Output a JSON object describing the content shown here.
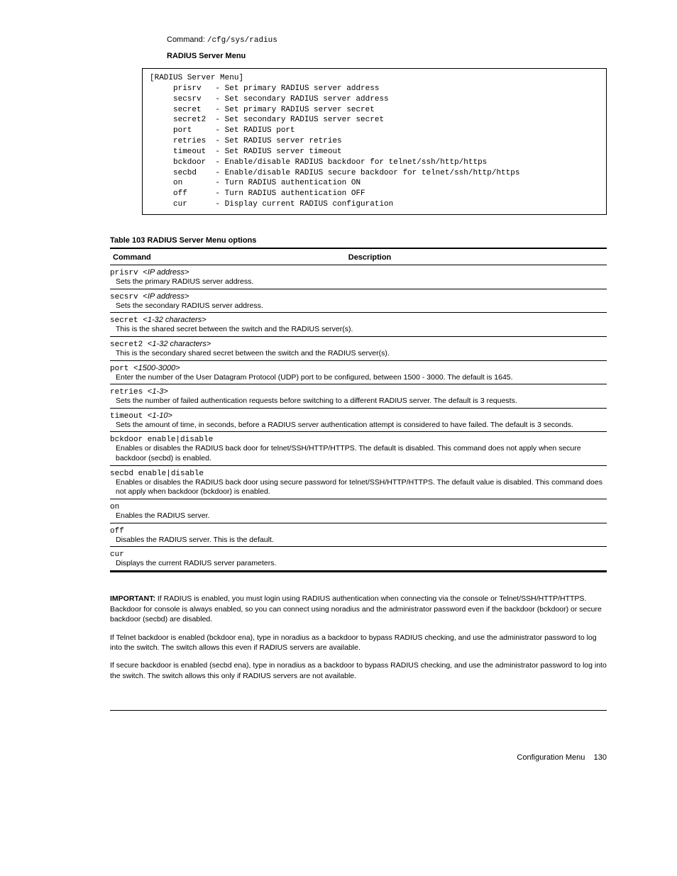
{
  "path_label": "Command:",
  "path_value": "/cfg/sys/radius",
  "menu_title": "RADIUS Server Menu",
  "menu_text": "[RADIUS Server Menu]\n     prisrv   - Set primary RADIUS server address\n     secsrv   - Set secondary RADIUS server address\n     secret   - Set primary RADIUS server secret\n     secret2  - Set secondary RADIUS server secret\n     port     - Set RADIUS port\n     retries  - Set RADIUS server retries\n     timeout  - Set RADIUS server timeout\n     bckdoor  - Enable/disable RADIUS backdoor for telnet/ssh/http/https\n     secbd    - Enable/disable RADIUS secure backdoor for telnet/ssh/http/https\n     on       - Turn RADIUS authentication ON\n     off      - Turn RADIUS authentication OFF\n     cur      - Display current RADIUS configuration",
  "table_title": "Table 103 RADIUS Server Menu options",
  "col1": "Command",
  "col2": "Description",
  "rows": [
    {
      "cmd_parts": [
        "prisrv <",
        "IP address",
        ">"
      ],
      "desc": "Sets the primary RADIUS server address."
    },
    {
      "cmd_parts": [
        "secsrv <",
        "IP address",
        ">"
      ],
      "desc": "Sets the secondary RADIUS server address."
    },
    {
      "cmd_parts": [
        "secret <",
        "1-32 characters",
        ">"
      ],
      "desc": "This is the shared secret between the switch and the RADIUS server(s)."
    },
    {
      "cmd_parts": [
        "secret2 <",
        "1-32 characters",
        ">"
      ],
      "desc": "This is the secondary shared secret between the switch and the RADIUS server(s)."
    },
    {
      "cmd_parts": [
        "port <",
        "1500-3000",
        ">"
      ],
      "desc": "Enter the number of the User Datagram Protocol (UDP) port to be configured, between 1500 - 3000. The default is 1645."
    },
    {
      "cmd_parts": [
        "retries <",
        "1-3",
        ">"
      ],
      "desc": "Sets the number of failed authentication requests before switching to a different RADIUS server. The default is 3 requests."
    },
    {
      "cmd_parts": [
        "timeout <",
        "1-10",
        ">"
      ],
      "desc": "Sets the amount of time, in seconds, before a RADIUS server authentication attempt is considered to have failed. The default is 3 seconds."
    },
    {
      "cmd_parts": [
        "bckdoor enable|disable"
      ],
      "desc": "Enables or disables the RADIUS back door for telnet/SSH/HTTP/HTTPS. The default is disabled. This command does not apply when secure backdoor (secbd) is enabled."
    },
    {
      "cmd_parts": [
        "secbd enable|disable"
      ],
      "desc": "Enables or disables the RADIUS back door using secure password for telnet/SSH/HTTP/HTTPS. The default value is disabled. This command does not apply when backdoor (bckdoor) is enabled."
    },
    {
      "cmd_parts": [
        "on"
      ],
      "desc": "Enables the RADIUS server."
    },
    {
      "cmd_parts": [
        "off"
      ],
      "desc": "Disables the RADIUS server. This is the default."
    },
    {
      "cmd_parts": [
        "cur"
      ],
      "desc": "Displays the current RADIUS server parameters."
    }
  ],
  "note1_label": "IMPORTANT:",
  "note1_text": " If RADIUS is enabled, you must login using RADIUS authentication when connecting via the console or Telnet/SSH/HTTP/HTTPS. Backdoor for console is always enabled, so you can connect using noradius and the administrator password even if the backdoor (bckdoor) or secure backdoor (secbd) are disabled.",
  "note2_text": "If Telnet backdoor is enabled (bckdoor ena), type in noradius as a backdoor to bypass RADIUS checking, and use the administrator password to log into the switch. The switch allows this even if RADIUS servers are available.",
  "note3_text": "If secure backdoor is enabled (secbd ena), type in noradius as a backdoor to bypass RADIUS checking, and use the administrator password to log into the switch. The switch allows this only if RADIUS servers are not available.",
  "footer_text": "Configuration Menu",
  "footer_page": "130"
}
